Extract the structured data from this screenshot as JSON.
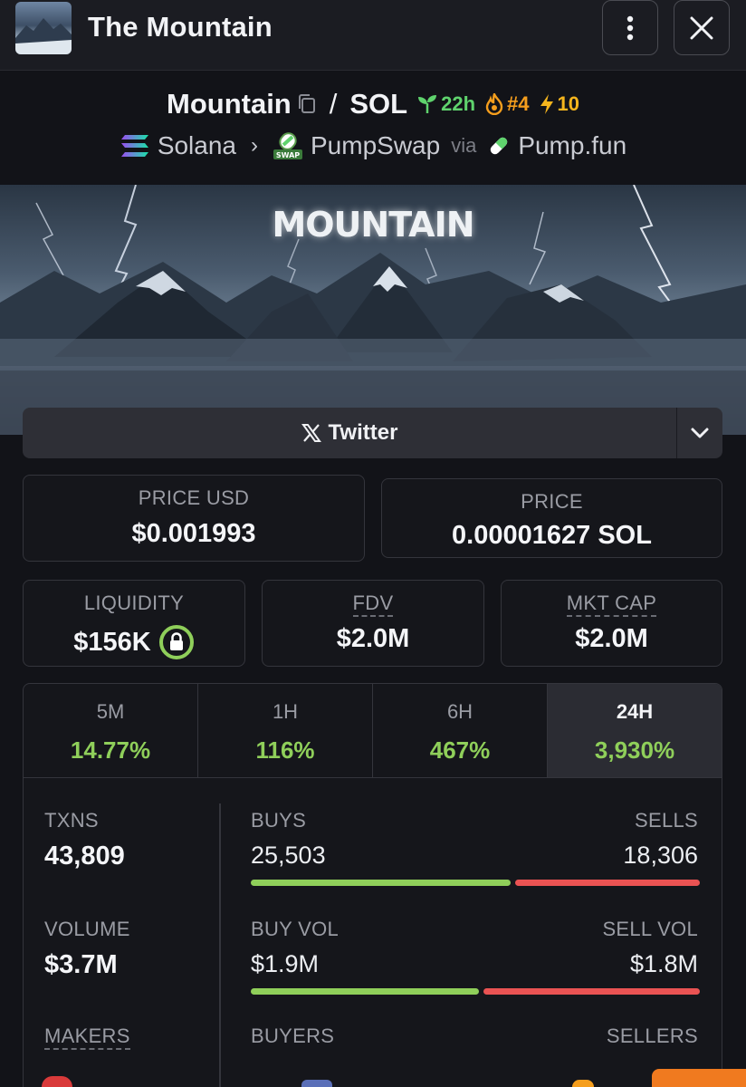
{
  "app_bar": {
    "title": "The Mountain",
    "more_icon": "vertical-dots-icon",
    "close_icon": "close-icon"
  },
  "pair": {
    "base_symbol": "Mountain",
    "quote_symbol": "SOL",
    "separator": "/",
    "age": "22h",
    "rank": "#4",
    "boosts": "10"
  },
  "route": {
    "chain": "Solana",
    "dex": "PumpSwap",
    "via_label": "via",
    "launchpad": "Pump.fun"
  },
  "banner": {
    "logo_text": "MOUNTAIN"
  },
  "social": {
    "twitter_label": "Twitter"
  },
  "prices": {
    "price_usd_label": "PRICE USD",
    "price_usd": "$0.001993",
    "price_label": "PRICE",
    "price_native": "0.00001627 SOL"
  },
  "metrics": {
    "liquidity_label": "LIQUIDITY",
    "liquidity": "$156K",
    "fdv_label": "FDV",
    "fdv": "$2.0M",
    "mkt_cap_label": "MKT CAP",
    "mkt_cap": "$2.0M"
  },
  "periods": [
    {
      "label": "5M",
      "change": "14.77%"
    },
    {
      "label": "1H",
      "change": "116%"
    },
    {
      "label": "6H",
      "change": "467%"
    },
    {
      "label": "24H",
      "change": "3,930%"
    }
  ],
  "selected_period": "24H",
  "stats": {
    "txns_label": "TXNS",
    "txns": "43,809",
    "buys_label": "BUYS",
    "buys": "25,503",
    "sells_label": "SELLS",
    "sells": "18,306",
    "buys_share": 0.582,
    "volume_label": "VOLUME",
    "volume": "$3.7M",
    "buy_vol_label": "BUY VOL",
    "buy_vol": "$1.9M",
    "sell_vol_label": "SELL VOL",
    "sell_vol": "$1.8M",
    "buy_vol_share": 0.513,
    "makers_label": "MAKERS",
    "buyers_label": "BUYERS",
    "sellers_label": "SELLERS"
  },
  "colors": {
    "positive": "#8fcf5a",
    "negative": "#ea5353",
    "age_green": "#5fd36d",
    "rank_orange": "#f59e1d"
  }
}
